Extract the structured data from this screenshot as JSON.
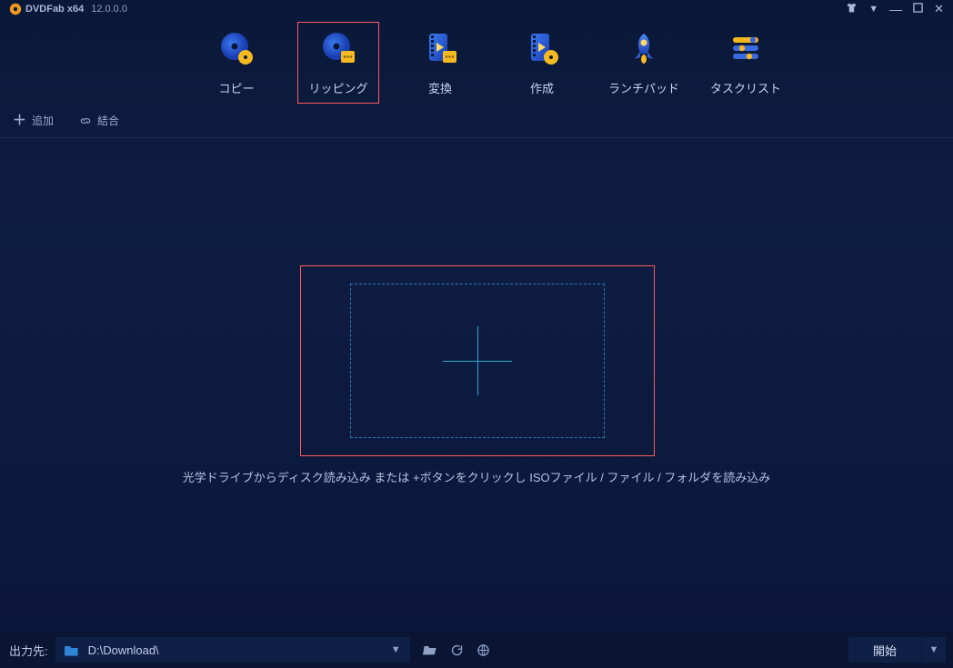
{
  "app": {
    "name": "DVDFab x64",
    "version": "12.0.0.0"
  },
  "tabs": [
    {
      "id": "copy",
      "label": "コピー"
    },
    {
      "id": "ripping",
      "label": "リッピング",
      "highlighted": true
    },
    {
      "id": "convert",
      "label": "変換"
    },
    {
      "id": "create",
      "label": "作成"
    },
    {
      "id": "launchpad",
      "label": "ランチパッド"
    },
    {
      "id": "tasklist",
      "label": "タスクリスト"
    }
  ],
  "subbar": {
    "add": "追加",
    "combine": "結合"
  },
  "drop": {
    "hint": "光学ドライブからディスク読み込み または +ボタンをクリックし ISOファイル / ファイル / フォルダを読み込み"
  },
  "bottom": {
    "output_label": "出力先:",
    "output_path": "D:\\Download\\",
    "start_label": "開始"
  }
}
